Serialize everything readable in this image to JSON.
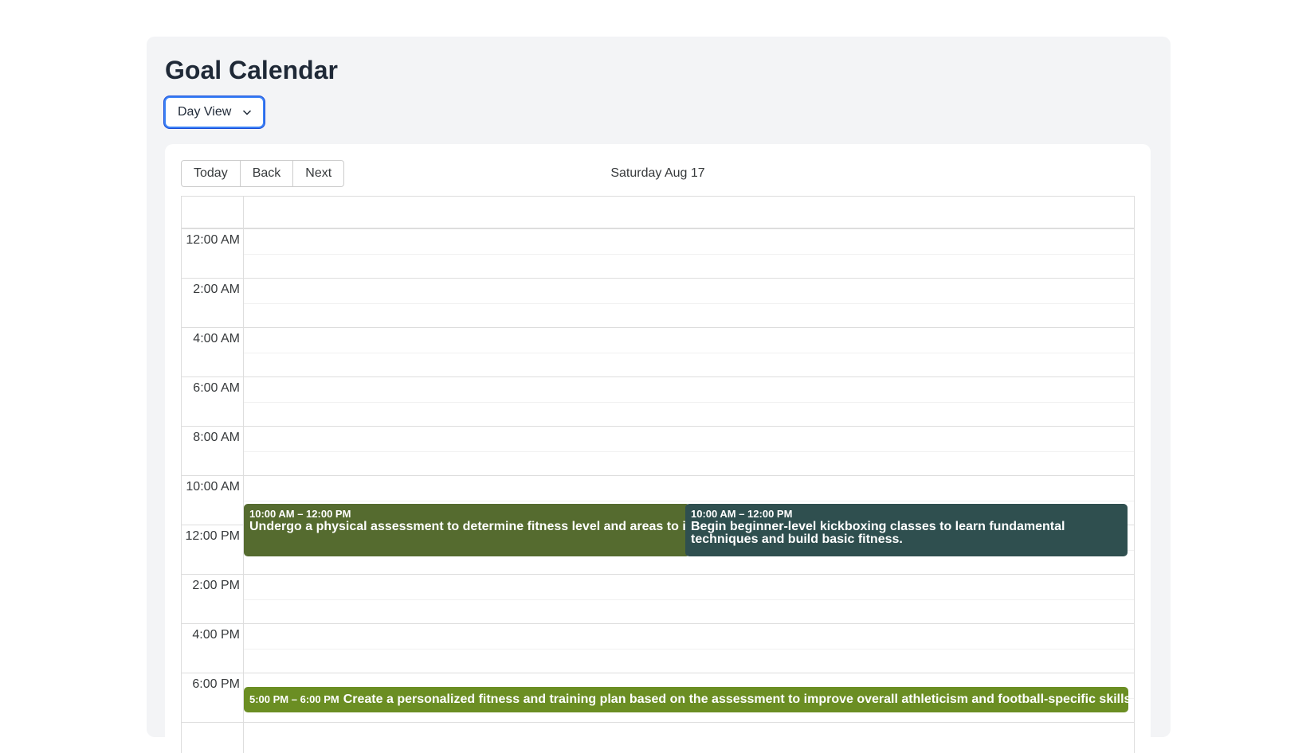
{
  "page": {
    "title": "Goal Calendar"
  },
  "view_select": {
    "value": "Day View",
    "icon": "chevron-down-icon"
  },
  "toolbar": {
    "today_label": "Today",
    "back_label": "Back",
    "next_label": "Next",
    "date_label": "Saturday Aug 17"
  },
  "time_slots": [
    "12:00 AM",
    "2:00 AM",
    "4:00 AM",
    "6:00 AM",
    "8:00 AM",
    "10:00 AM",
    "12:00 PM",
    "2:00 PM",
    "4:00 PM",
    "6:00 PM"
  ],
  "events": [
    {
      "time": "10:00 AM – 12:00 PM",
      "title": "Undergo a physical assessment to determine fitness level and areas to improve.",
      "color": "#556b2f"
    },
    {
      "time": "10:00 AM – 12:00 PM",
      "title": "Begin beginner-level kickboxing classes to learn fundamental techniques and build basic fitness.",
      "color": "#2f4f4f"
    },
    {
      "time": "5:00 PM – 6:00 PM",
      "title": "Create a personalized fitness and training plan based on the assessment to improve overall athleticism and football-specific skills.",
      "color": "#6b8e23"
    }
  ],
  "colors": {
    "page_background": "#f3f4f6",
    "select_focus_border": "#3b82f6",
    "grid_border": "#dddddd"
  }
}
